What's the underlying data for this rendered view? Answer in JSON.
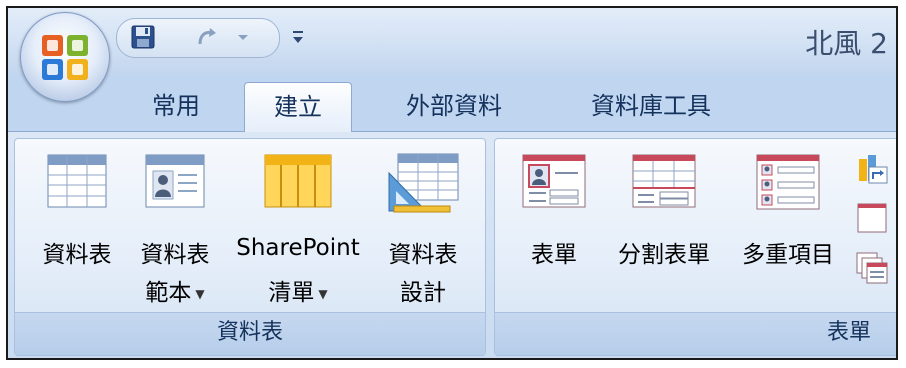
{
  "window": {
    "title": "北風 2"
  },
  "quick_access": {
    "save_icon": "save-icon",
    "redo_icon": "redo-icon"
  },
  "tabs": [
    {
      "label": "常用",
      "active": false
    },
    {
      "label": "建立",
      "active": true
    },
    {
      "label": "外部資料",
      "active": false
    },
    {
      "label": "資料庫工具",
      "active": false
    }
  ],
  "groups": {
    "table": {
      "label": "資料表",
      "commands": {
        "datasheet": {
          "line1": "資料表"
        },
        "template": {
          "line1": "資料表",
          "line2": "範本"
        },
        "sharepoint": {
          "line1": "SharePoint",
          "line2": "清單"
        },
        "design": {
          "line1": "資料表",
          "line2": "設計"
        }
      }
    },
    "form": {
      "label": "表單",
      "commands": {
        "form": {
          "line1": "表單"
        },
        "split": {
          "line1": "分割表單"
        },
        "multiple": {
          "line1": "多重項目"
        }
      }
    }
  },
  "colors": {
    "ribbon": "#dce7f6",
    "tab_text": "#15325c",
    "accent_table": "#f2b316",
    "accent_form": "#c8485c"
  }
}
